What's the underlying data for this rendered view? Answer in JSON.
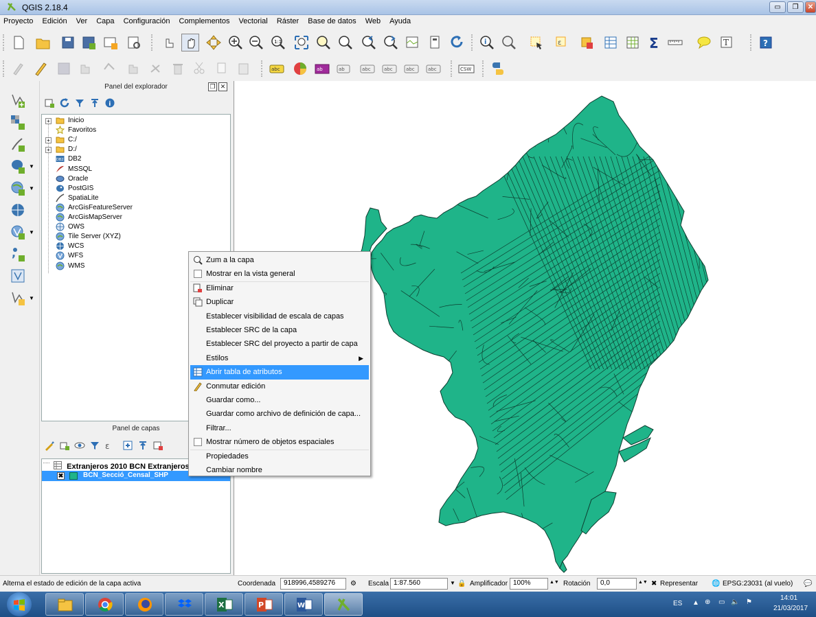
{
  "window": {
    "title": "QGIS 2.18.4",
    "controls": [
      "minimize",
      "maximize",
      "close"
    ]
  },
  "menubar": [
    "Proyecto",
    "Edición",
    "Ver",
    "Capa",
    "Configuración",
    "Complementos",
    "Vectorial",
    "Ráster",
    "Base de datos",
    "Web",
    "Ayuda"
  ],
  "browser_panel": {
    "title": "Panel del explorador",
    "items": [
      {
        "label": "Inicio",
        "icon": "folder-icon",
        "expandable": true
      },
      {
        "label": "Favoritos",
        "icon": "star-icon",
        "expandable": false
      },
      {
        "label": "C:/",
        "icon": "folder-icon",
        "expandable": true
      },
      {
        "label": "D:/",
        "icon": "folder-icon",
        "expandable": true
      },
      {
        "label": "DB2",
        "icon": "db2-icon",
        "expandable": false
      },
      {
        "label": "MSSQL",
        "icon": "mssql-icon",
        "expandable": false
      },
      {
        "label": "Oracle",
        "icon": "oracle-icon",
        "expandable": false
      },
      {
        "label": "PostGIS",
        "icon": "postgis-icon",
        "expandable": false
      },
      {
        "label": "SpatiaLite",
        "icon": "spatialite-icon",
        "expandable": false
      },
      {
        "label": "ArcGisFeatureServer",
        "icon": "arcgis-icon",
        "expandable": false
      },
      {
        "label": "ArcGisMapServer",
        "icon": "arcgis-icon",
        "expandable": false
      },
      {
        "label": "OWS",
        "icon": "ows-icon",
        "expandable": false
      },
      {
        "label": "Tile Server (XYZ)",
        "icon": "tile-server-icon",
        "expandable": false
      },
      {
        "label": "WCS",
        "icon": "wcs-icon",
        "expandable": false
      },
      {
        "label": "WFS",
        "icon": "wfs-icon",
        "expandable": false
      },
      {
        "label": "WMS",
        "icon": "wms-icon",
        "expandable": false
      }
    ]
  },
  "layers_panel": {
    "title": "Panel de capas",
    "layers": [
      {
        "name": "Extranjeros 2010 BCN Extranjeros",
        "type": "table"
      },
      {
        "name": "BCN_Secció_Censal_SHP",
        "checked": true,
        "selected": true,
        "color": "#1fb489"
      }
    ]
  },
  "context_menu": {
    "items": [
      {
        "label": "Zum a la capa",
        "icon": "zoom-layer-icon"
      },
      {
        "label": "Mostrar en la vista general",
        "icon": "checkbox-icon"
      },
      {
        "label": "Eliminar",
        "icon": "remove-layer-icon"
      },
      {
        "label": "Duplicar",
        "icon": "duplicate-icon"
      },
      {
        "label": "Establecer visibilidad de escala de capas"
      },
      {
        "label": "Establecer SRC de la capa"
      },
      {
        "label": "Establecer SRC del proyecto a partir de capa"
      },
      {
        "label": "Estilos",
        "submenu": true
      },
      {
        "label": "Abrir tabla de atributos",
        "icon": "attribute-table-icon",
        "highlighted": true
      },
      {
        "label": "Conmutar edición",
        "icon": "pencil-icon"
      },
      {
        "label": "Guardar como..."
      },
      {
        "label": "Guardar como archivo de definición de capa..."
      },
      {
        "label": "Filtrar..."
      },
      {
        "label": "Mostrar número de objetos espaciales",
        "icon": "checkbox-icon"
      },
      {
        "label": "Propiedades"
      },
      {
        "label": "Cambiar nombre"
      }
    ]
  },
  "statusbar": {
    "message": "Alterna el estado de edición de la capa activa",
    "coord_label": "Coordenada",
    "coord_value": "918996,4589276",
    "scale_label": "Escala",
    "scale_value": "1:87.560",
    "magnifier_label": "Amplificador",
    "magnifier_value": "100%",
    "rotation_label": "Rotación",
    "rotation_value": "0,0",
    "render_label": "Representar",
    "crs": "EPSG:23031 (al vuelo)"
  },
  "taskbar": {
    "apps": [
      "windows-start-icon",
      "file-explorer-icon",
      "chrome-icon",
      "firefox-icon",
      "dropbox-icon",
      "excel-icon",
      "powerpoint-icon",
      "word-icon",
      "qgis-icon"
    ],
    "language": "ES",
    "time": "14:01",
    "date": "21/03/2017"
  },
  "colors": {
    "map_fill": "#1fb489",
    "selection": "#3399ff",
    "taskbar": "#2a5f99"
  }
}
